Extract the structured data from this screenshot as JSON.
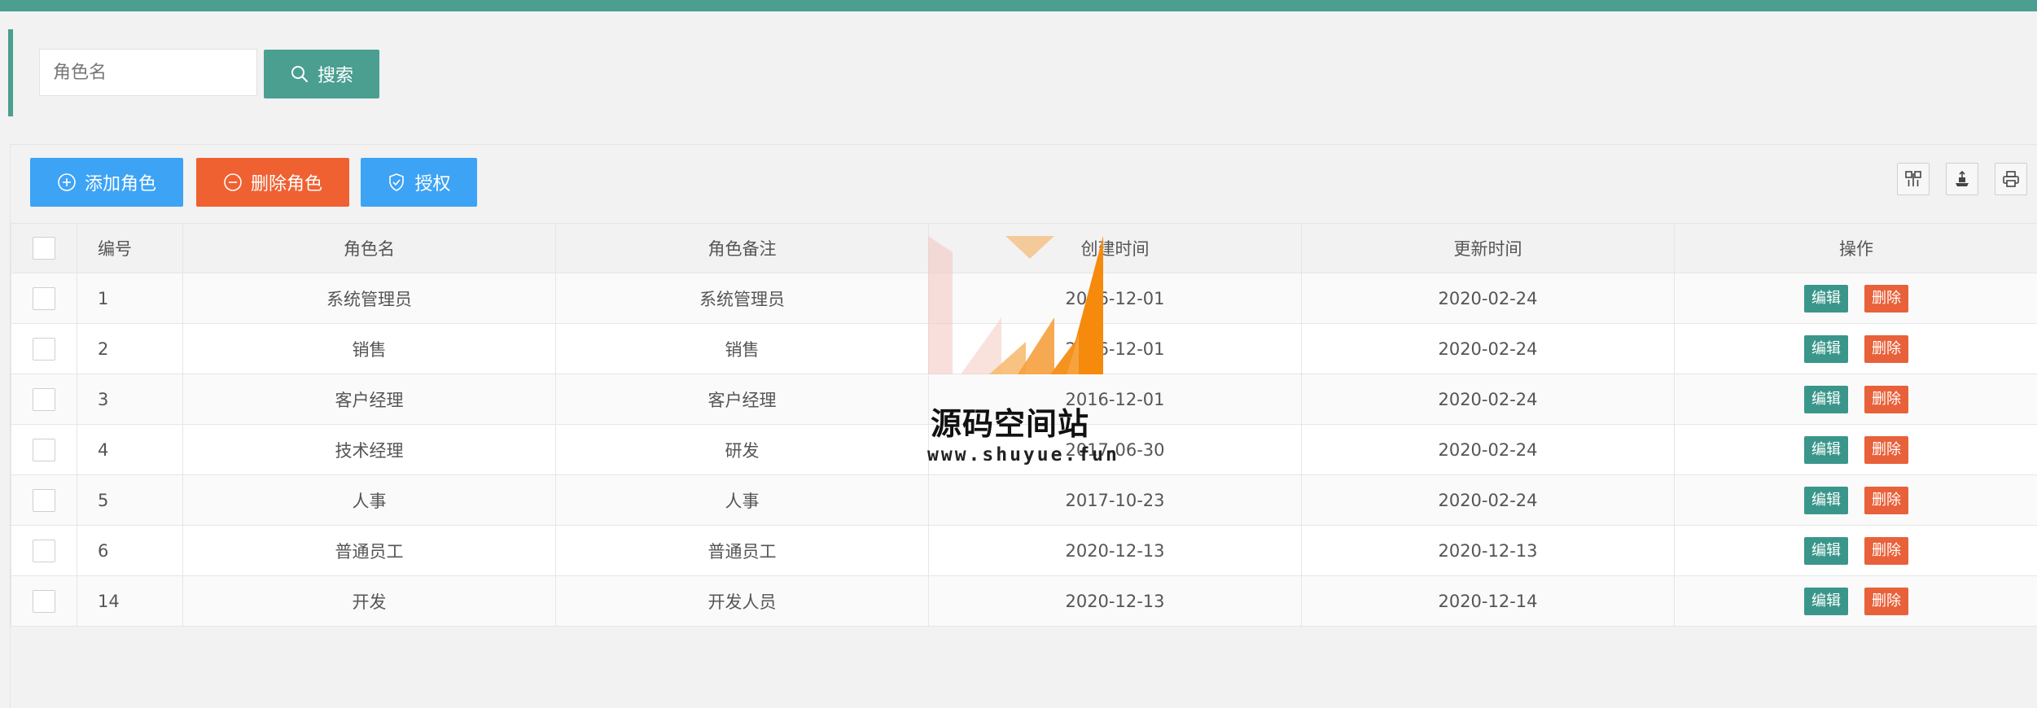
{
  "search": {
    "placeholder": "角色名",
    "button_label": "搜索"
  },
  "toolbar": {
    "add_label": "添加角色",
    "delete_label": "删除角色",
    "auth_label": "授权"
  },
  "table": {
    "headers": {
      "id": "编号",
      "name": "角色名",
      "remark": "角色备注",
      "created": "创建时间",
      "updated": "更新时间",
      "actions": "操作"
    },
    "edit_label": "编辑",
    "delete_label": "删除",
    "rows": [
      {
        "id": "1",
        "name": "系统管理员",
        "remark": "系统管理员",
        "created": "2016-12-01",
        "updated": "2020-02-24"
      },
      {
        "id": "2",
        "name": "销售",
        "remark": "销售",
        "created": "2016-12-01",
        "updated": "2020-02-24"
      },
      {
        "id": "3",
        "name": "客户经理",
        "remark": "客户经理",
        "created": "2016-12-01",
        "updated": "2020-02-24"
      },
      {
        "id": "4",
        "name": "技术经理",
        "remark": "研发",
        "created": "2017-06-30",
        "updated": "2020-02-24"
      },
      {
        "id": "5",
        "name": "人事",
        "remark": "人事",
        "created": "2017-10-23",
        "updated": "2020-02-24"
      },
      {
        "id": "6",
        "name": "普通员工",
        "remark": "普通员工",
        "created": "2020-12-13",
        "updated": "2020-12-13"
      },
      {
        "id": "14",
        "name": "开发",
        "remark": "开发人员",
        "created": "2020-12-13",
        "updated": "2020-12-14"
      }
    ]
  },
  "watermark": {
    "title": "源码空间站",
    "url": "www.shuyue.fun"
  },
  "colors": {
    "primary": "#4a9f91",
    "blue": "#3da3f5",
    "danger": "#f06132",
    "link": "#f0b13c"
  }
}
